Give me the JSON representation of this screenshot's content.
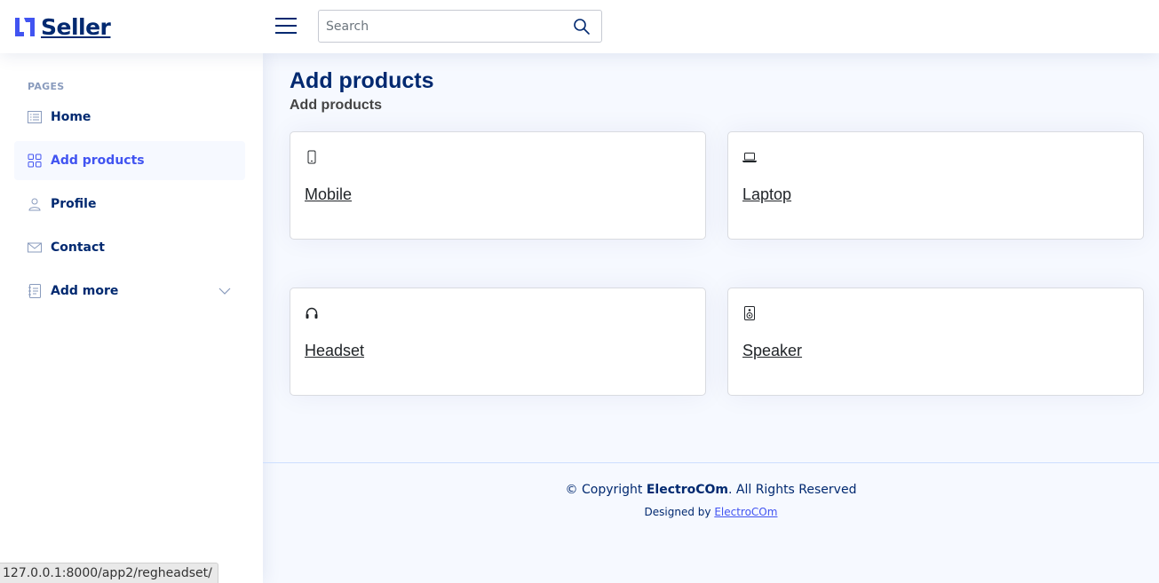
{
  "header": {
    "logo_text": "Seller",
    "search": {
      "placeholder": "Search",
      "value": ""
    }
  },
  "sidebar": {
    "heading": "PAGES",
    "items": [
      {
        "label": "Home",
        "icon": "grid-list-icon"
      },
      {
        "label": "Add products",
        "icon": "grid-icon",
        "active": true
      },
      {
        "label": "Profile",
        "icon": "person-icon"
      },
      {
        "label": "Contact",
        "icon": "envelope-icon"
      },
      {
        "label": "Add more",
        "icon": "journal-icon",
        "expandable": true
      }
    ]
  },
  "main": {
    "title": "Add products",
    "subtitle": "Add products",
    "cards": [
      {
        "label": "Mobile",
        "icon": "phone-icon"
      },
      {
        "label": "Laptop",
        "icon": "laptop-icon"
      },
      {
        "label": "Headset",
        "icon": "headset-icon"
      },
      {
        "label": "Speaker",
        "icon": "speaker-icon"
      }
    ]
  },
  "footer": {
    "copyright_prefix": "© Copyright ",
    "brand": "ElectroCOm",
    "copyright_suffix": ". All Rights Reserved",
    "designed_by": "Designed by ",
    "designer_link": "ElectroCOm"
  },
  "statusbar": {
    "url": "127.0.0.1:8000/app2/regheadset/"
  },
  "colors": {
    "primary": "#012970",
    "accent": "#4154f1",
    "background": "#f6f9ff"
  }
}
